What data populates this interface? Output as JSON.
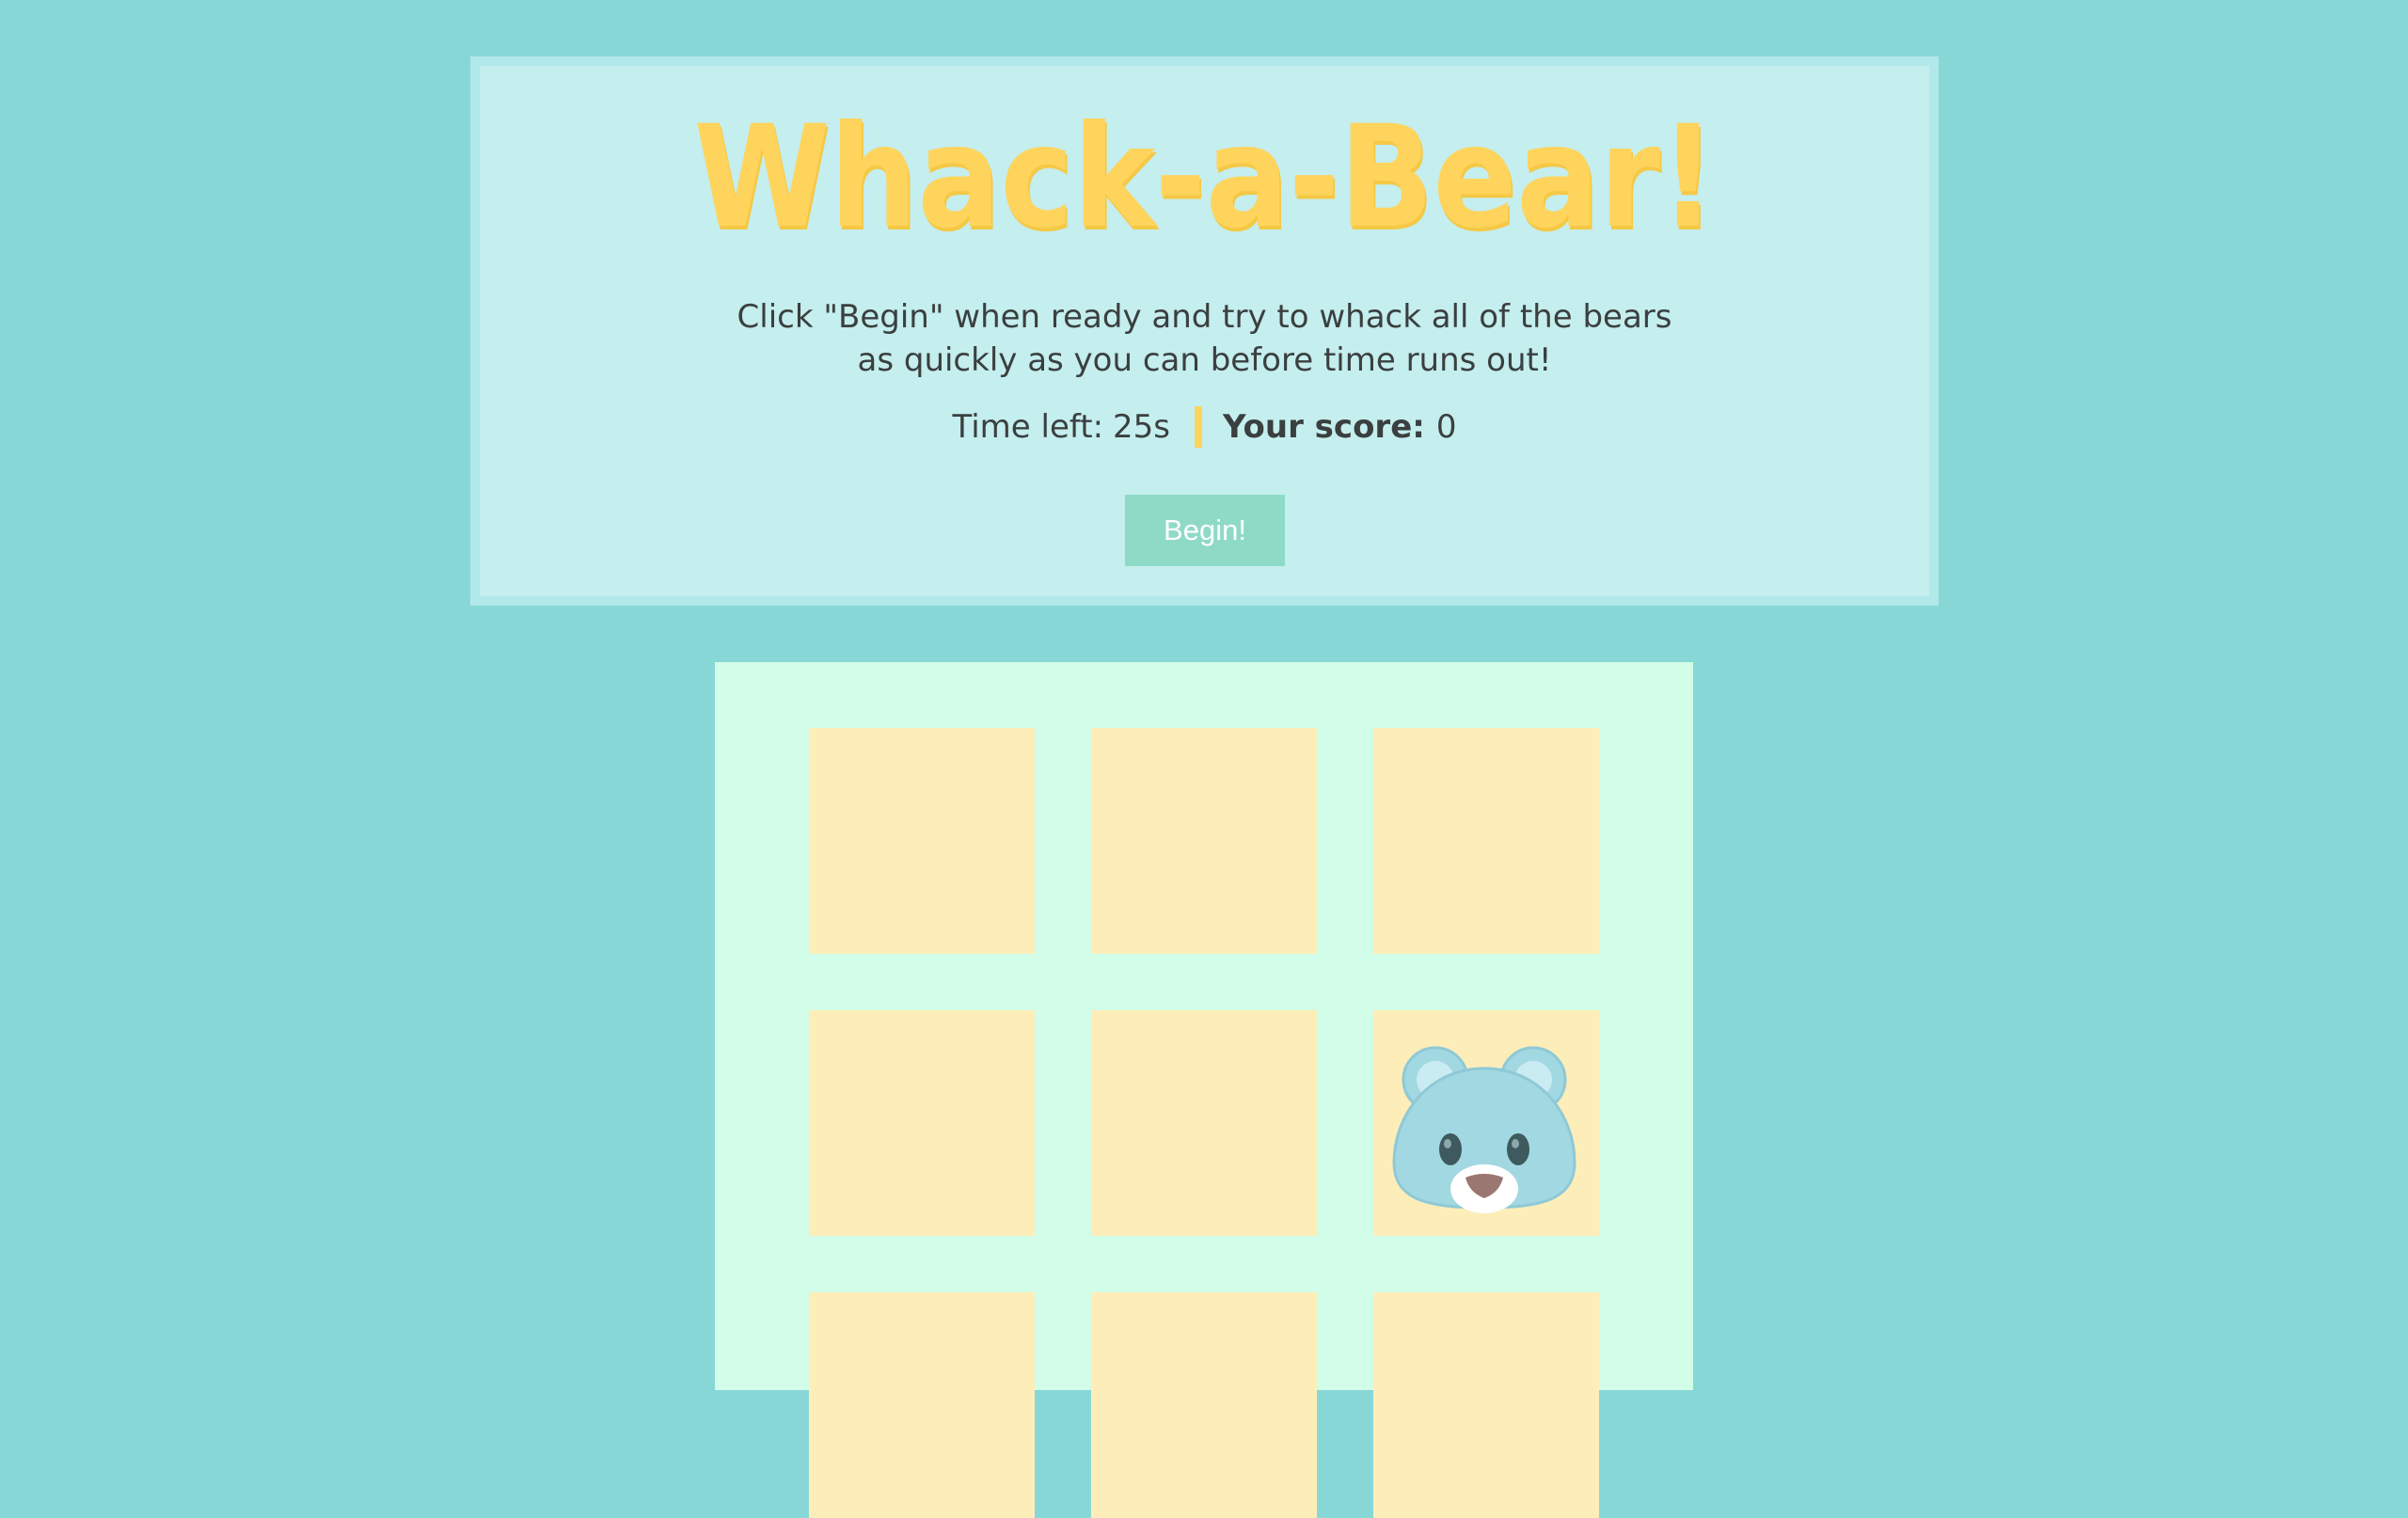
{
  "header": {
    "title": "Whack-a-Bear!",
    "instructions_line1": "Click \"Begin\" when ready and try to whack all of the bears",
    "instructions_line2": "as quickly as you can before time runs out!",
    "time_label": "Time left:",
    "time_value": "25s",
    "score_label": "Your score:",
    "score_value": "0",
    "begin_label": "Begin!"
  },
  "board": {
    "holes": [
      {
        "id": 1,
        "has_bear": false
      },
      {
        "id": 2,
        "has_bear": false
      },
      {
        "id": 3,
        "has_bear": false
      },
      {
        "id": 4,
        "has_bear": false
      },
      {
        "id": 5,
        "has_bear": false
      },
      {
        "id": 6,
        "has_bear": true,
        "icon": "bear-face-icon"
      },
      {
        "id": 7,
        "has_bear": false
      },
      {
        "id": 8,
        "has_bear": false
      },
      {
        "id": 9,
        "has_bear": false
      }
    ]
  },
  "colors": {
    "background": "#88d7d7",
    "panel": "#c5eeee",
    "title": "#ffd45c",
    "button": "#8fdac6",
    "board": "#d2fde8",
    "hole": "#fdedb9",
    "bear": "#a2d8e2"
  }
}
